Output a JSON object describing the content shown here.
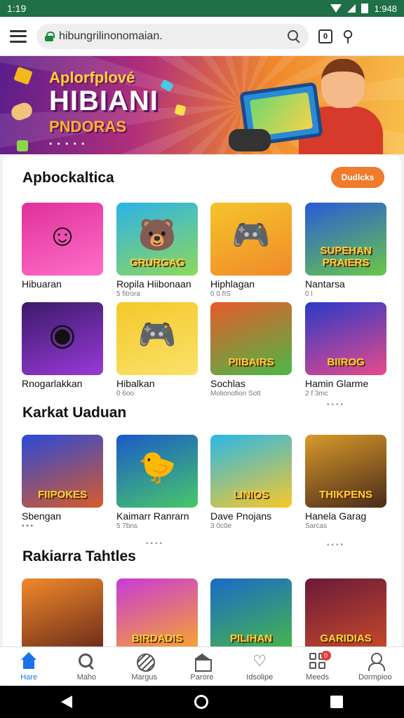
{
  "status": {
    "time": "1:19",
    "right": "1:948"
  },
  "browser": {
    "url": "hibungrilinonomaian.",
    "tab_count": "0"
  },
  "banner": {
    "subtitle": "Aplorfplové",
    "title": "HIBIANI",
    "tagline": "PNDORAS",
    "dots": "• • • • •"
  },
  "more_label": "Dudlcks",
  "sections": [
    {
      "title": "Apbockaltica",
      "games": [
        {
          "name": "Hibuaran",
          "meta": "",
          "caption": "",
          "colors": [
            "#e0309a",
            "#ff6fc8"
          ],
          "glyph": "☺"
        },
        {
          "name": "Ropila Hiibonaan",
          "meta": "5 fitrora",
          "caption": "GRURGAG",
          "colors": [
            "#2bb3e8",
            "#8fd85a"
          ],
          "glyph": "🐻"
        },
        {
          "name": "Hiphlagan",
          "meta": "0 0 fIS",
          "caption": "",
          "colors": [
            "#f5c42a",
            "#f08a2a"
          ],
          "glyph": "🎮"
        },
        {
          "name": "Nantarsa",
          "meta": "0 l",
          "caption": "SUPEHAN PRAIERS",
          "colors": [
            "#2a5ad8",
            "#6ac848"
          ],
          "glyph": ""
        },
        {
          "name": "Rnogarlakkan",
          "meta": "",
          "caption": "",
          "colors": [
            "#3a1a6a",
            "#9a3ad8"
          ],
          "glyph": "◉"
        },
        {
          "name": "Hibalkan",
          "meta": "0 6oo",
          "caption": "",
          "colors": [
            "#f6c82a",
            "#f8e26a"
          ],
          "glyph": "🎮"
        },
        {
          "name": "Sochlas",
          "meta": "Molionofion Sott",
          "caption": "PIIBAIRS",
          "colors": [
            "#e85a2a",
            "#4ab848"
          ],
          "glyph": ""
        },
        {
          "name": "Hamin Glarme",
          "meta": "2 f 3mc",
          "caption": "BIIROG",
          "colors": [
            "#2a3ac8",
            "#e84a8a"
          ],
          "glyph": ""
        }
      ]
    },
    {
      "title": "Karkat Uaduan",
      "games": [
        {
          "name": "Sbengan",
          "meta": "• • •",
          "caption": "FIIPOKES",
          "colors": [
            "#2a4ad8",
            "#d85a2a"
          ],
          "glyph": ""
        },
        {
          "name": "Kaimarr Ranrarn",
          "meta": "5 7bns",
          "caption": "",
          "colors": [
            "#1a5ac8",
            "#48c868"
          ],
          "glyph": "🐤"
        },
        {
          "name": "Dave Pnojans",
          "meta": "3 0c0e",
          "caption": "LINIOS",
          "colors": [
            "#2ab8e8",
            "#f8c82a"
          ],
          "glyph": ""
        },
        {
          "name": "Hanela Garag",
          "meta": "Sarcas",
          "caption": "THIKPENS",
          "colors": [
            "#d89a2a",
            "#4a2a1a"
          ],
          "glyph": ""
        }
      ]
    },
    {
      "title": "Rakiarra Tahtles",
      "games": [
        {
          "name": "",
          "meta": "",
          "caption": "",
          "colors": [
            "#f08a2a",
            "#6a2a1a"
          ],
          "glyph": ""
        },
        {
          "name": "",
          "meta": "",
          "caption": "BIRDADIS",
          "colors": [
            "#c83ad8",
            "#f8a82a"
          ],
          "glyph": ""
        },
        {
          "name": "",
          "meta": "",
          "caption": "PILIHAN",
          "colors": [
            "#1a6ac8",
            "#48b848"
          ],
          "glyph": ""
        },
        {
          "name": "",
          "meta": "",
          "caption": "GARIDIAS",
          "colors": [
            "#6a1a3a",
            "#c84a2a"
          ],
          "glyph": ""
        }
      ]
    }
  ],
  "nav": [
    {
      "label": "Hare",
      "icon": "home-icon"
    },
    {
      "label": "Maho",
      "icon": "search-icon"
    },
    {
      "label": "Margus",
      "icon": "ball-icon"
    },
    {
      "label": "Parore",
      "icon": "store-icon"
    },
    {
      "label": "Idsolipe",
      "icon": "heart-icon"
    },
    {
      "label": "Meeds",
      "icon": "grid-icon",
      "badge": "0"
    },
    {
      "label": "Dormpioo",
      "icon": "profile-icon"
    }
  ]
}
